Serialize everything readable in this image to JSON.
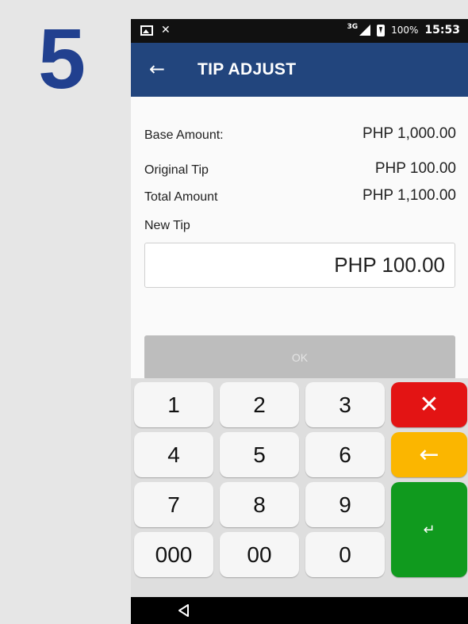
{
  "step": {
    "number": "5"
  },
  "status_bar": {
    "network": "3G",
    "battery": "100%",
    "time": "15:53",
    "icons": [
      "image-icon",
      "muted-icon",
      "signal-icon",
      "battery-charging-icon"
    ]
  },
  "app_bar": {
    "title": "TIP ADJUST",
    "back_icon": "arrow-left-icon",
    "color": "#22457d"
  },
  "details": {
    "base_amount_label": "Base Amount:",
    "base_amount_value": "PHP 1,000.00",
    "original_tip_label": "Original Tip",
    "original_tip_value": "PHP 100.00",
    "total_amount_label": "Total Amount",
    "total_amount_value": "PHP 1,100.00",
    "new_tip_label": "New Tip",
    "new_tip_value": "PHP 100.00"
  },
  "ok_button": {
    "label": "OK"
  },
  "keypad": {
    "keys": [
      "1",
      "2",
      "3",
      "4",
      "5",
      "6",
      "7",
      "8",
      "9",
      "000",
      "00",
      "0"
    ],
    "cancel_glyph": "✕",
    "backspace_glyph": "←",
    "enter_glyph": "↵",
    "colors": {
      "cancel": "#e31414",
      "backspace": "#fbb600",
      "enter": "#109a1e"
    }
  },
  "nav_bar": {
    "back_icon": "triangle-back-icon"
  }
}
